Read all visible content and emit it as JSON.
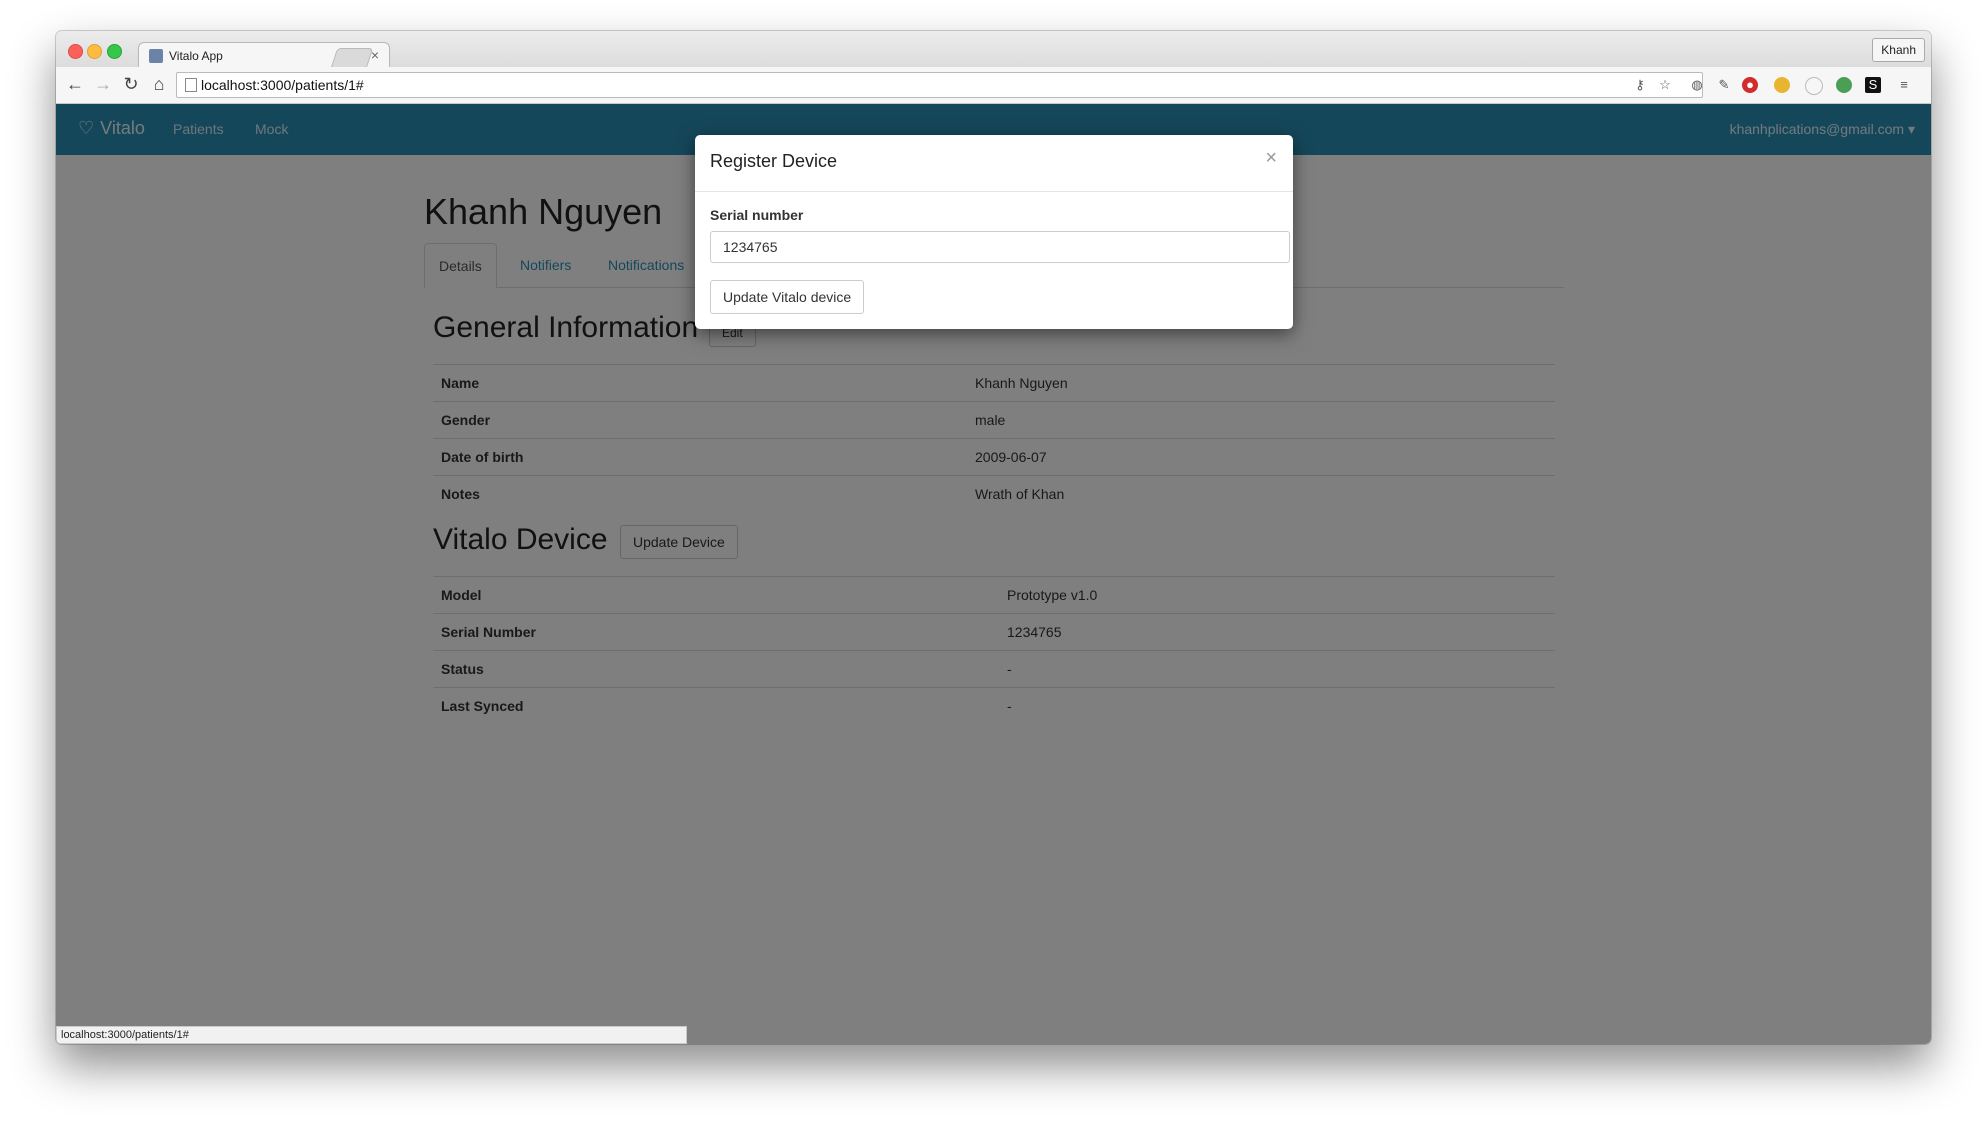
{
  "browser": {
    "tab_title": "Vitalo App",
    "tab_close": "×",
    "profile_name": "Khanh",
    "url": "localhost:3000/patients/1#",
    "status_url": "localhost:3000/patients/1#"
  },
  "navbar": {
    "brand": "Vitalo",
    "links": [
      "Patients",
      "Mock"
    ],
    "user_email": "khanhplications@gmail.com",
    "caret": "▾"
  },
  "patient": {
    "name": "Khanh Nguyen",
    "tabs": [
      "Details",
      "Notifiers",
      "Notifications"
    ]
  },
  "general": {
    "title": "General Information",
    "edit_label": "Edit",
    "rows": [
      {
        "label": "Name",
        "value": "Khanh Nguyen"
      },
      {
        "label": "Gender",
        "value": "male"
      },
      {
        "label": "Date of birth",
        "value": "2009-06-07"
      },
      {
        "label": "Notes",
        "value": "Wrath of Khan"
      }
    ]
  },
  "device": {
    "title": "Vitalo Device",
    "update_label": "Update Device",
    "rows": [
      {
        "label": "Model",
        "value": "Prototype v1.0"
      },
      {
        "label": "Serial Number",
        "value": "1234765"
      },
      {
        "label": "Status",
        "value": "-"
      },
      {
        "label": "Last Synced",
        "value": "-"
      }
    ]
  },
  "modal": {
    "title": "Register Device",
    "close": "×",
    "field_label": "Serial number",
    "serial_value": "1234765",
    "submit_label": "Update Vitalo device"
  },
  "colors": {
    "navbar": "#2a8fb5",
    "link": "#2a8fb5"
  }
}
